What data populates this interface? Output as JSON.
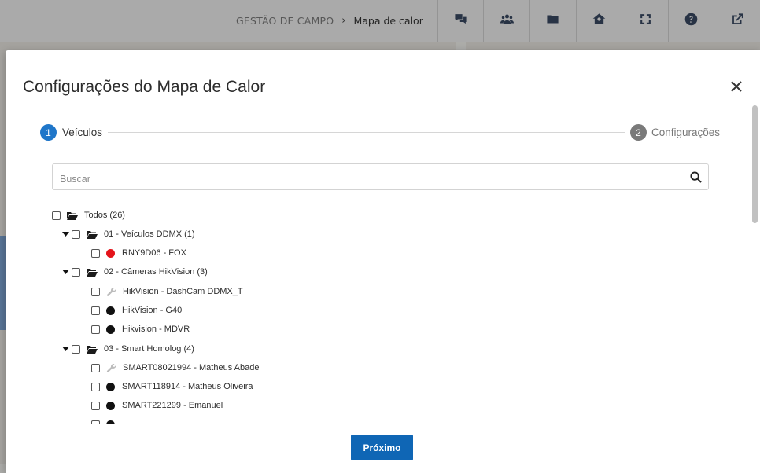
{
  "header": {
    "breadcrumb_root": "GESTÃO DE CAMPO",
    "breadcrumb_separator": "›",
    "breadcrumb_current": "Mapa de calor",
    "tools": [
      "chat-icon",
      "users-icon",
      "folder-icon",
      "home-icon",
      "fullscreen-icon",
      "help-icon",
      "external-link-icon"
    ]
  },
  "modal": {
    "title": "Configurações do Mapa de Calor",
    "steps": [
      {
        "number": "1",
        "label": "Veículos",
        "active": true
      },
      {
        "number": "2",
        "label": "Configurações",
        "active": false
      }
    ],
    "search_placeholder": "Buscar",
    "tree": {
      "root_label": "Todos (26)",
      "groups": [
        {
          "label": "01 - Veículos DDMX (1)",
          "items": [
            {
              "label": "RNY9D06 - FOX",
              "status": "red"
            }
          ]
        },
        {
          "label": "02 - Câmeras HikVision (3)",
          "items": [
            {
              "label": "HikVision - DashCam DDMX_T",
              "status": "maintenance"
            },
            {
              "label": "HikVision - G40",
              "status": "black"
            },
            {
              "label": "Hikvision - MDVR",
              "status": "black"
            }
          ]
        },
        {
          "label": "03 - Smart Homolog (4)",
          "items": [
            {
              "label": "SMART08021994 - Matheus Abade",
              "status": "maintenance"
            },
            {
              "label": "SMART118914 - Matheus Oliveira",
              "status": "black"
            },
            {
              "label": "SMART221299 - Emanuel",
              "status": "black"
            }
          ]
        }
      ]
    },
    "next_button": "Próximo"
  },
  "colors": {
    "primary": "#0f66b5",
    "step_active": "#1f76c9",
    "step_inactive": "#7a7a7a",
    "status_red": "#e4131a",
    "status_black": "#111111"
  }
}
